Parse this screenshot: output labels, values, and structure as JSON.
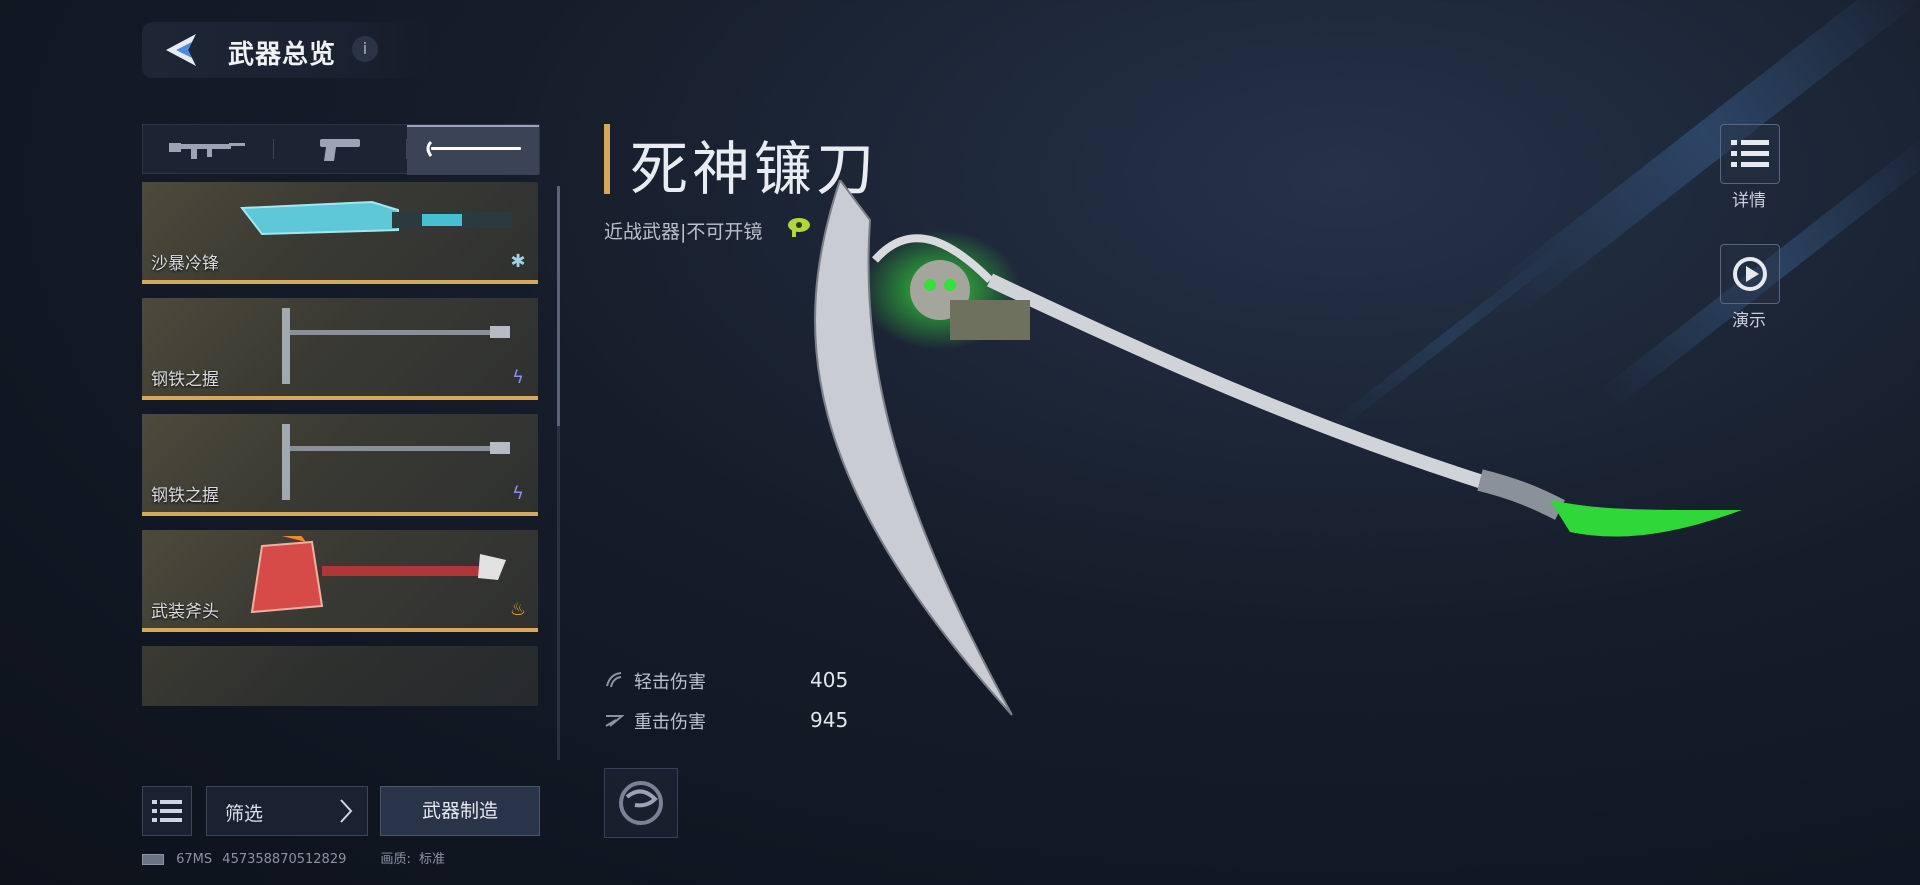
{
  "header": {
    "title": "武器总览",
    "info": "i"
  },
  "tabs": [
    {
      "name": "rifle-tab",
      "icon": "rifle-icon"
    },
    {
      "name": "pistol-tab",
      "icon": "pistol-icon"
    },
    {
      "name": "melee-tab",
      "icon": "melee-icon",
      "active": true
    }
  ],
  "weapon_list": [
    {
      "name": "沙暴冷锋",
      "type_icon": "snowflake-icon"
    },
    {
      "name": "钢铁之握",
      "type_icon": "lightning-icon"
    },
    {
      "name": "钢铁之握",
      "type_icon": "lightning-icon"
    },
    {
      "name": "武装斧头",
      "type_icon": "flame-icon"
    }
  ],
  "controls": {
    "filter": "筛选",
    "craft": "武器制造"
  },
  "status": {
    "ping": "67MS",
    "id": "457358870512829",
    "quality_label": "画质:",
    "quality": "标准"
  },
  "weapon": {
    "name": "死神镰刀",
    "subtitle": "近战武器|不可开镜",
    "stats": [
      {
        "label": "轻击伤害",
        "value": "405"
      },
      {
        "label": "重击伤害",
        "value": "945"
      }
    ]
  },
  "side": {
    "details": "详情",
    "demo": "演示"
  },
  "colors": {
    "accent": "#d6a85a",
    "glow": "#35e03a"
  }
}
